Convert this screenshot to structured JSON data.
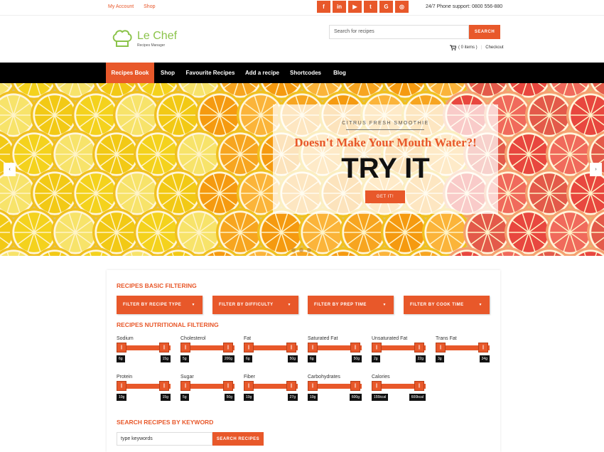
{
  "topbar": {
    "links": [
      "My Account",
      "Shop"
    ],
    "socials": [
      {
        "icon": "facebook-icon",
        "glyph": "f"
      },
      {
        "icon": "linkedin-icon",
        "glyph": "in"
      },
      {
        "icon": "youtube-icon",
        "glyph": "▶"
      },
      {
        "icon": "twitter-icon",
        "glyph": "t"
      },
      {
        "icon": "google-icon",
        "glyph": "G"
      },
      {
        "icon": "dribbble-icon",
        "glyph": "◎"
      }
    ],
    "phone": "24/7 Phone support: 0800 556-880"
  },
  "header": {
    "brand": "Le Chef",
    "brand_sub": "Recipes Manager",
    "search_placeholder": "Search for recipes",
    "search_button": "SEARCH",
    "cart_text": "( 0 items )",
    "checkout": "Checkout"
  },
  "nav": {
    "items": [
      "Recipes Book",
      "Shop",
      "Favourite Recipes",
      "Add a recipe",
      "Shortcodes",
      "Blog"
    ],
    "active": "Recipes Book"
  },
  "hero": {
    "eyebrow": "CITRUS FRESH SMOOTHIE",
    "headline": "Doesn't Make Your Mouth Water?!",
    "cta_big": "TRY IT",
    "cta_button": "GET IT!",
    "prev": "‹",
    "next": "›",
    "slide_count": 3
  },
  "filters": {
    "basic_title": "RECIPES BASIC FILTERING",
    "buttons": [
      "FILTER BY RECIPE TYPE",
      "FILTER BY DIFFICULTY",
      "FILTER BY PREP TIME",
      "FILTER BY COOK TIME"
    ],
    "caret": "▼",
    "nutrition_title": "RECIPES NUTRITIONAL FILTERING",
    "sliders": [
      {
        "label": "Sodium",
        "min": "6g",
        "max": "15g"
      },
      {
        "label": "Cholesterol",
        "min": "5g",
        "max": "200g"
      },
      {
        "label": "Fat",
        "min": "6g",
        "max": "50g"
      },
      {
        "label": "Saturated Fat",
        "min": "6g",
        "max": "50g"
      },
      {
        "label": "Unsaturated Fat",
        "min": "2g",
        "max": "22g"
      },
      {
        "label": "Trans Fat",
        "min": "3g",
        "max": "34g"
      },
      {
        "label": "Protein",
        "min": "10g",
        "max": "15g"
      },
      {
        "label": "Sugar",
        "min": "5g",
        "max": "50g"
      },
      {
        "label": "Fiber",
        "min": "10g",
        "max": "27g"
      },
      {
        "label": "Carbohydrates",
        "min": "10g",
        "max": "600g"
      },
      {
        "label": "Calories",
        "min": "155kcal",
        "max": "600kcal"
      }
    ],
    "handle_glyph": "||",
    "keyword_title": "SEARCH RECIPES BY KEYWORD",
    "keyword_placeholder": "type keywords",
    "keyword_button": "SEARCH RECIPES"
  },
  "colors": {
    "accent": "#e8582a",
    "brand_green": "#8bc34a",
    "nav_bg": "#000000"
  }
}
